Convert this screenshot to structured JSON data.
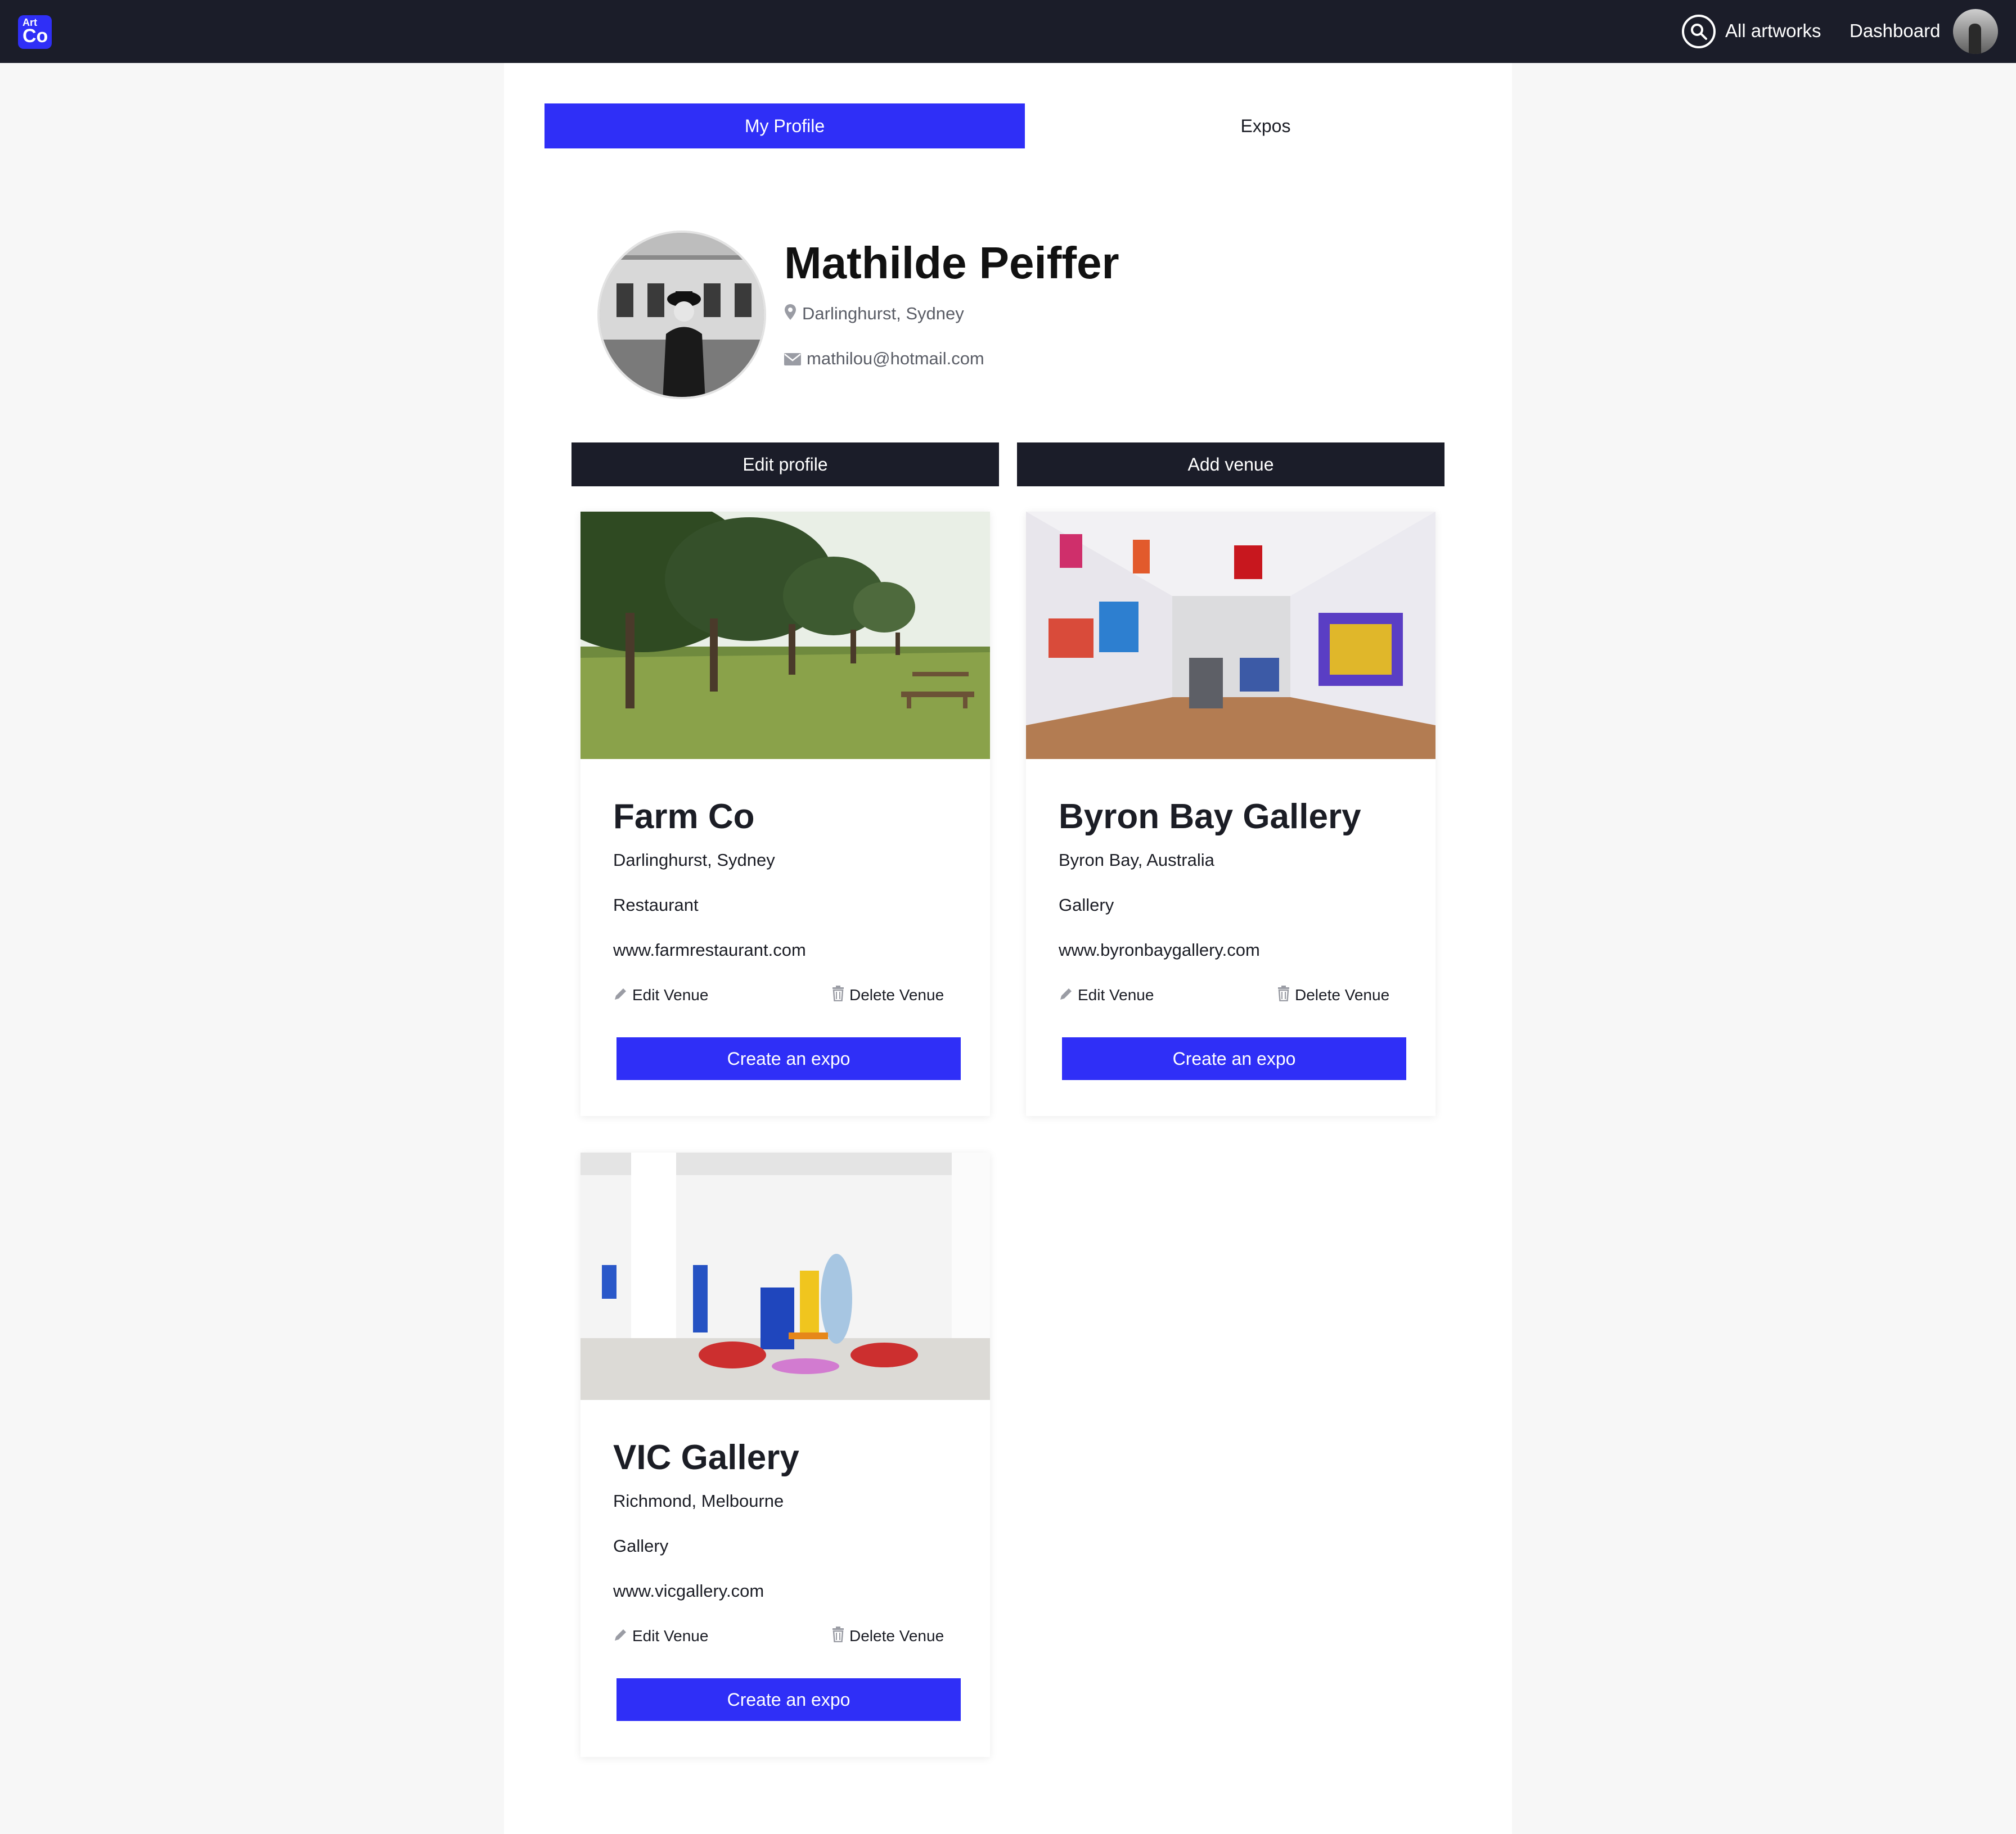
{
  "app": {
    "logo_top": "Art",
    "logo_bottom": "Co"
  },
  "nav": {
    "search_icon": "search-icon",
    "all_artworks": "All artworks",
    "dashboard": "Dashboard"
  },
  "tabs": [
    {
      "label": "My Profile",
      "active": true
    },
    {
      "label": "Expos",
      "active": false
    }
  ],
  "profile": {
    "name": "Mathilde Peiffer",
    "location": "Darlinghurst, Sydney",
    "email": "mathilou@hotmail.com"
  },
  "actions": {
    "edit_profile": "Edit profile",
    "add_venue": "Add venue"
  },
  "venues": [
    {
      "name": "Farm Co",
      "location": "Darlinghurst, Sydney",
      "type": "Restaurant",
      "website": "www.farmrestaurant.com",
      "edit_label": "Edit Venue",
      "delete_label": "Delete Venue",
      "cta": "Create an expo"
    },
    {
      "name": "Byron Bay Gallery",
      "location": "Byron Bay, Australia",
      "type": "Gallery",
      "website": "www.byronbaygallery.com",
      "edit_label": "Edit Venue",
      "delete_label": "Delete Venue",
      "cta": "Create an expo"
    },
    {
      "name": "VIC Gallery",
      "location": "Richmond, Melbourne",
      "type": "Gallery",
      "website": "www.vicgallery.com",
      "edit_label": "Edit Venue",
      "delete_label": "Delete Venue",
      "cta": "Create an expo"
    }
  ],
  "colors": {
    "accent": "#2f2ff7",
    "dark": "#1b1d29",
    "background": "#f7f7f7"
  }
}
